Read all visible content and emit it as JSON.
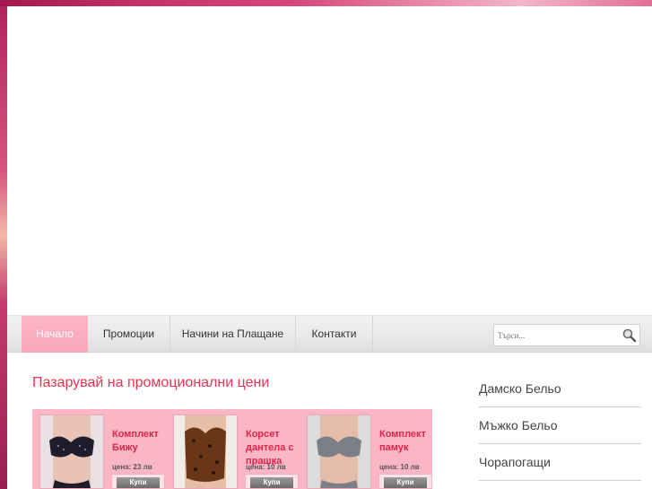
{
  "nav": {
    "items": [
      {
        "label": "Начало",
        "active": true
      },
      {
        "label": "Промоции",
        "active": false
      },
      {
        "label": "Начини на Плащане",
        "active": false
      },
      {
        "label": "Контакти",
        "active": false
      }
    ]
  },
  "search": {
    "placeholder": "Търси...",
    "icon": "magnifier-icon"
  },
  "main": {
    "title": "Пазарувай на промоционални цени",
    "products": [
      {
        "name": "Комплект Бижу",
        "price": "цена: 23 лв",
        "buy_label": "Купи"
      },
      {
        "name": "Корсет дантела с прашка",
        "price": "цена: 10 лв",
        "buy_label": "Купи"
      },
      {
        "name": "Комплект памук",
        "price": "цена: 10 лв",
        "buy_label": "Купи"
      }
    ]
  },
  "sidebar": {
    "items": [
      {
        "label": "Дамско Бельо"
      },
      {
        "label": "Мъжко Бельо"
      },
      {
        "label": "Чорапогащи"
      }
    ]
  },
  "colors": {
    "accent_pink": "#fbb6c6",
    "title_red": "#e8334f",
    "product_name_red": "#e0234a",
    "nav_active": "#f8a8b9"
  }
}
